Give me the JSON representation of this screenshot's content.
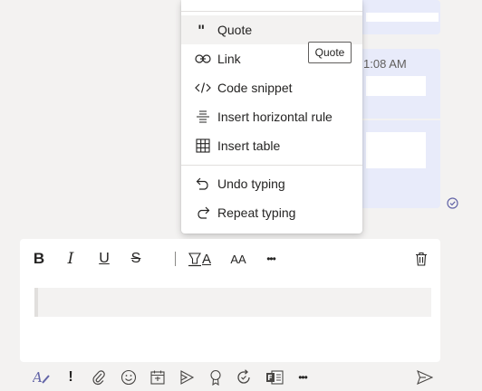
{
  "background": {
    "message_time": "1:08 AM"
  },
  "menu": {
    "items": [
      {
        "label": "Quote",
        "icon": "quote-icon"
      },
      {
        "label": "Link",
        "icon": "link-icon"
      },
      {
        "label": "Code snippet",
        "icon": "code-icon"
      },
      {
        "label": "Insert horizontal rule",
        "icon": "horizontal-rule-icon"
      },
      {
        "label": "Insert table",
        "icon": "table-icon"
      },
      {
        "label": "Undo typing",
        "icon": "undo-icon"
      },
      {
        "label": "Repeat typing",
        "icon": "redo-icon"
      }
    ]
  },
  "tooltip": {
    "text": "Quote"
  },
  "toolbar": {
    "bold": "B",
    "italic": "I",
    "underline": "U",
    "strikethrough": "S",
    "font_color": "A",
    "font_size": "AA",
    "more": "•••"
  },
  "compose": {
    "value": "",
    "placeholder": ""
  },
  "actions": {
    "important": "!",
    "more": "•••"
  },
  "colors": {
    "accent": "#6264a7",
    "bubble": "#e8ebfa",
    "background": "#f3f2f1"
  }
}
